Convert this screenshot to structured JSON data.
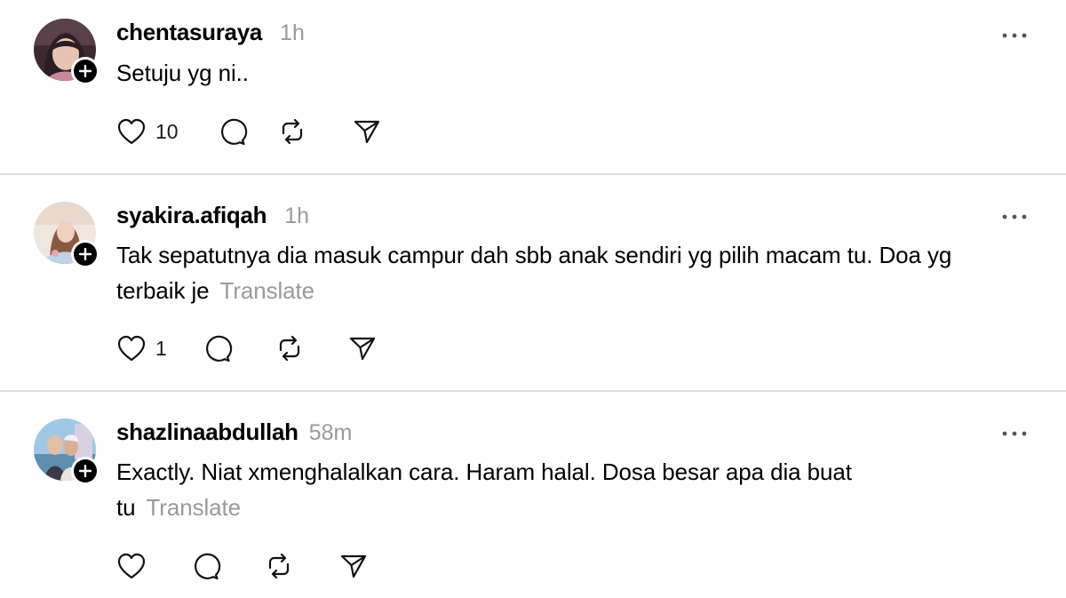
{
  "posts": [
    {
      "username": "chentasuraya",
      "time": "1h",
      "text_lines": [
        "Setuju yg ni.."
      ],
      "translate_label": "",
      "likes": "10"
    },
    {
      "username": "syakira.afiqah",
      "time": "1h",
      "text_lines": [
        "Tak sepatutnya dia masuk campur dah sbb anak sendiri yg pilih macam tu. Doa yg",
        "terbaik je"
      ],
      "translate_label": "Translate",
      "likes": "1"
    },
    {
      "username": "shazlinaabdullah",
      "time": "58m",
      "text_lines": [
        "Exactly. Niat xmenghalalkan cara. Haram halal. Dosa besar apa dia buat",
        "tu"
      ],
      "translate_label": "Translate",
      "likes": ""
    }
  ],
  "icons": {
    "like": "heart-icon",
    "reply": "comment-icon",
    "repost": "repost-icon",
    "share": "send-icon",
    "more": "more-options-icon",
    "follow": "follow-plus-icon"
  }
}
